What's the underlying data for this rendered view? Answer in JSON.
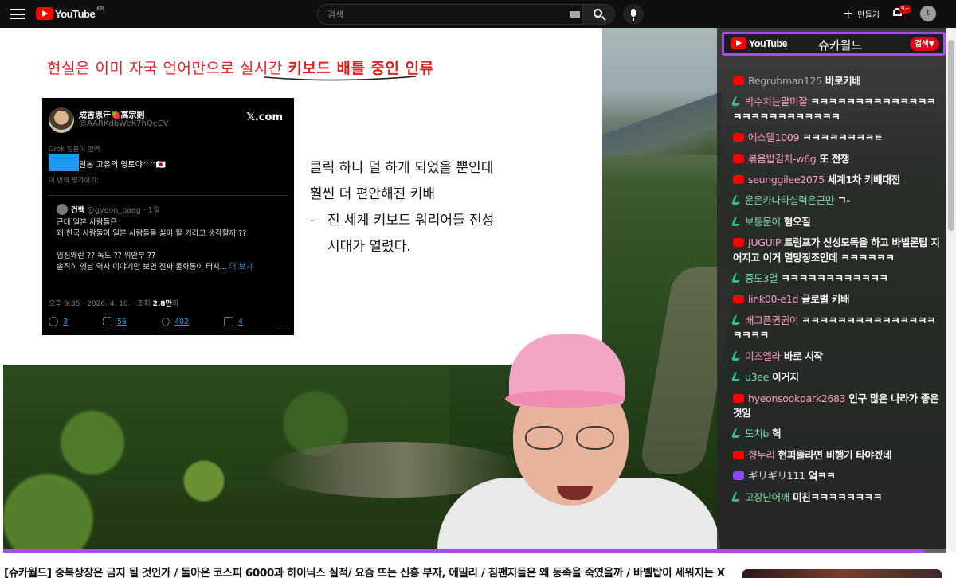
{
  "header": {
    "logo_text": "YouTube",
    "region": "KR",
    "search_placeholder": "검색",
    "create_label": "만들기",
    "notif_count": "9+",
    "avatar_letter": "t"
  },
  "slide": {
    "title_plain": "현실은 이미 자국 언어만으로 ",
    "title_underlined": "실시간 ",
    "title_bold": "키보드 배틀 중인 인류",
    "body_lines": [
      "클릭 하나 덜 하게 되었을 뿐인데",
      "훨씬 더 편안해진 키배"
    ],
    "bullet_dash": "-",
    "bullet_line1": "전 세계 키보드 워리어들 전성",
    "bullet_line2": "시대가 열렸다."
  },
  "tweet": {
    "name": "成吉思汗🍓高宗則",
    "handle": "@AARKdbWeK7hQeCV",
    "site": "𝕏.com",
    "grok_label": "Grok 일본어 번역",
    "text": "일본 고유의 영토야^^🇯🇵",
    "rate_label": "이 번역 평가하기:",
    "quote_name": "건백",
    "quote_meta": "@gyeon_baeg · 1일",
    "quote_lines": [
      "근데 일본 사람들은",
      "왜 한국 사람들이 일본 사람들을 싫어 할 거라고 생각할까 ??",
      "",
      "임진왜란 ?? 독도 ?? 위안부 ??",
      "솔직히 옛날 역사 이야기만 보면 진짜 울화통이 터지..."
    ],
    "quote_more": "더 보기",
    "meta_time": "오후 9:35 · 2026. 4. 10. · 조회 ",
    "meta_views": "2.8만",
    "meta_suffix": "회",
    "replies": "3",
    "retweets": "56",
    "likes": "402",
    "bookmarks": "4"
  },
  "chat": {
    "platform_label": "YouTube",
    "channel_name": "슈카월드",
    "search_label": "검색▼",
    "messages": [
      {
        "badge": "yt",
        "name": "Regrubman125",
        "text": "바로키배",
        "color": "gr"
      },
      {
        "badge": "mem",
        "name": "박수치는말미잘",
        "text": "ㅋㅋㅋㅋㅋㅋㅋㅋㅋㅋㅋㅋㅋㅋㅋㅋㅋㅋㅋㅋㅋㅋㅋㅋㅋㅋ",
        "color": "pk"
      },
      {
        "badge": "yt",
        "name": "에스텔1009",
        "text": "ㅋㅋㅋㅋㅋㅋㅋㅋㅌ",
        "color": "pk"
      },
      {
        "badge": "yt",
        "name": "볶음밥김치-w6g",
        "text": "또 전쟁",
        "color": "pk"
      },
      {
        "badge": "yt",
        "name": "seunggilee2075",
        "text": "세계1차 키배대전",
        "color": "pk"
      },
      {
        "badge": "mem",
        "name": "운은카나타실력은근만",
        "text": "ㄱ-",
        "color": "g"
      },
      {
        "badge": "mem",
        "name": "보통문어",
        "text": "혐오질",
        "color": "g"
      },
      {
        "badge": "yt",
        "name": "JUGUIP",
        "text": "트럼프가 신성모독을 하고 바빌론탑 지어지고 이거 멸망징조인데 ㅋㅋㅋㅋㅋㅋ",
        "color": "pk"
      },
      {
        "badge": "mem",
        "name": "중도3열",
        "text": "ㅋㅋㅋㅋㅋㅋㅋㅋㅋㅋㅋㅋ",
        "color": "g"
      },
      {
        "badge": "yt",
        "name": "link00-e1d",
        "text": "글로벌 키배",
        "color": "pk"
      },
      {
        "badge": "mem",
        "name": "배고픈귄귄이",
        "text": "ㅋㅋㅋㅋㅋㅋㅋㅋㅋㅋㅋㅋㅋㅋㅋㅋㅋㅋㅋ",
        "color": "pk"
      },
      {
        "badge": "mem",
        "name": "이즈엘라",
        "text": "바로 시작",
        "color": "pk"
      },
      {
        "badge": "mem",
        "name": "u3ee",
        "text": "이거지",
        "color": "g"
      },
      {
        "badge": "yt",
        "name": "hyeonsookpark2683",
        "text": "인구 많은 나라가 좋은 것임",
        "color": "pk"
      },
      {
        "badge": "mem",
        "name": "도치b",
        "text": "헉",
        "color": "g"
      },
      {
        "badge": "yt",
        "name": "향누리",
        "text": "현피뜰라면 비행기 타야겠네",
        "color": "pk"
      },
      {
        "badge": "tw",
        "name": "ギリギリ111",
        "text": "엌ㅋㅋ",
        "color": "wh"
      },
      {
        "badge": "mem",
        "name": "고장난어깨",
        "text": "미친ㅋㅋㅋㅋㅋㅋㅋㅋ",
        "color": "g"
      }
    ]
  },
  "player": {
    "progress": 0.97
  },
  "video": {
    "title": "[슈카월드] 중복상장은 금지 될 것인가 / 돌아온 코스피 6000과 하이닉스 실적/ 요즘 뜨는 신흥 부자, 에밀리 / 침팬지들은 왜 동족을 죽였을까 / 바벨탑이 세워지는 X"
  },
  "colors": {
    "accent_purple": "#a64df0",
    "yt_red": "#ff0000",
    "slide_red": "#e01f1f"
  }
}
